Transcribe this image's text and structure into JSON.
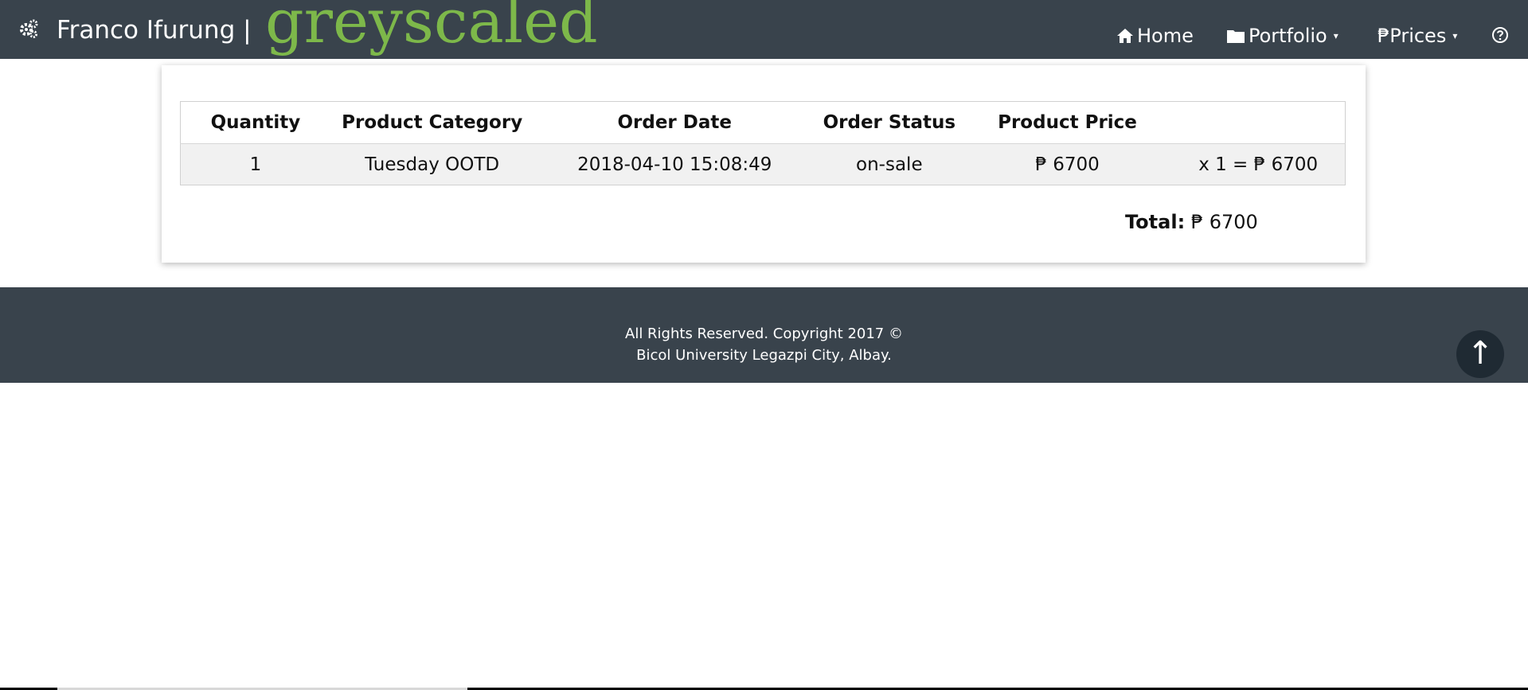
{
  "navbar": {
    "brand_name": "Franco Ifurung |",
    "logo_text": "greyscaled",
    "items": [
      {
        "label": "Home"
      },
      {
        "label": "Portfolio"
      },
      {
        "label": "₱Prices"
      }
    ],
    "colors": {
      "background": "#39434c",
      "logo": "#7db84a"
    }
  },
  "orders": {
    "headers": [
      "Quantity",
      "Product Category",
      "Order Date",
      "Order Status",
      "Product Price",
      ""
    ],
    "rows": [
      [
        "1",
        "Tuesday OOTD",
        "2018-04-10 15:08:49",
        "on-sale",
        "₱ 6700",
        "x 1 = ₱ 6700"
      ]
    ],
    "total_label": "Total:",
    "total_value": "₱ 6700"
  },
  "footer": {
    "line1": "All Rights Reserved. Copyright 2017 ©",
    "line2": "Bicol University Legazpi City, Albay."
  },
  "back_to_top": {
    "glyph": "↑"
  }
}
